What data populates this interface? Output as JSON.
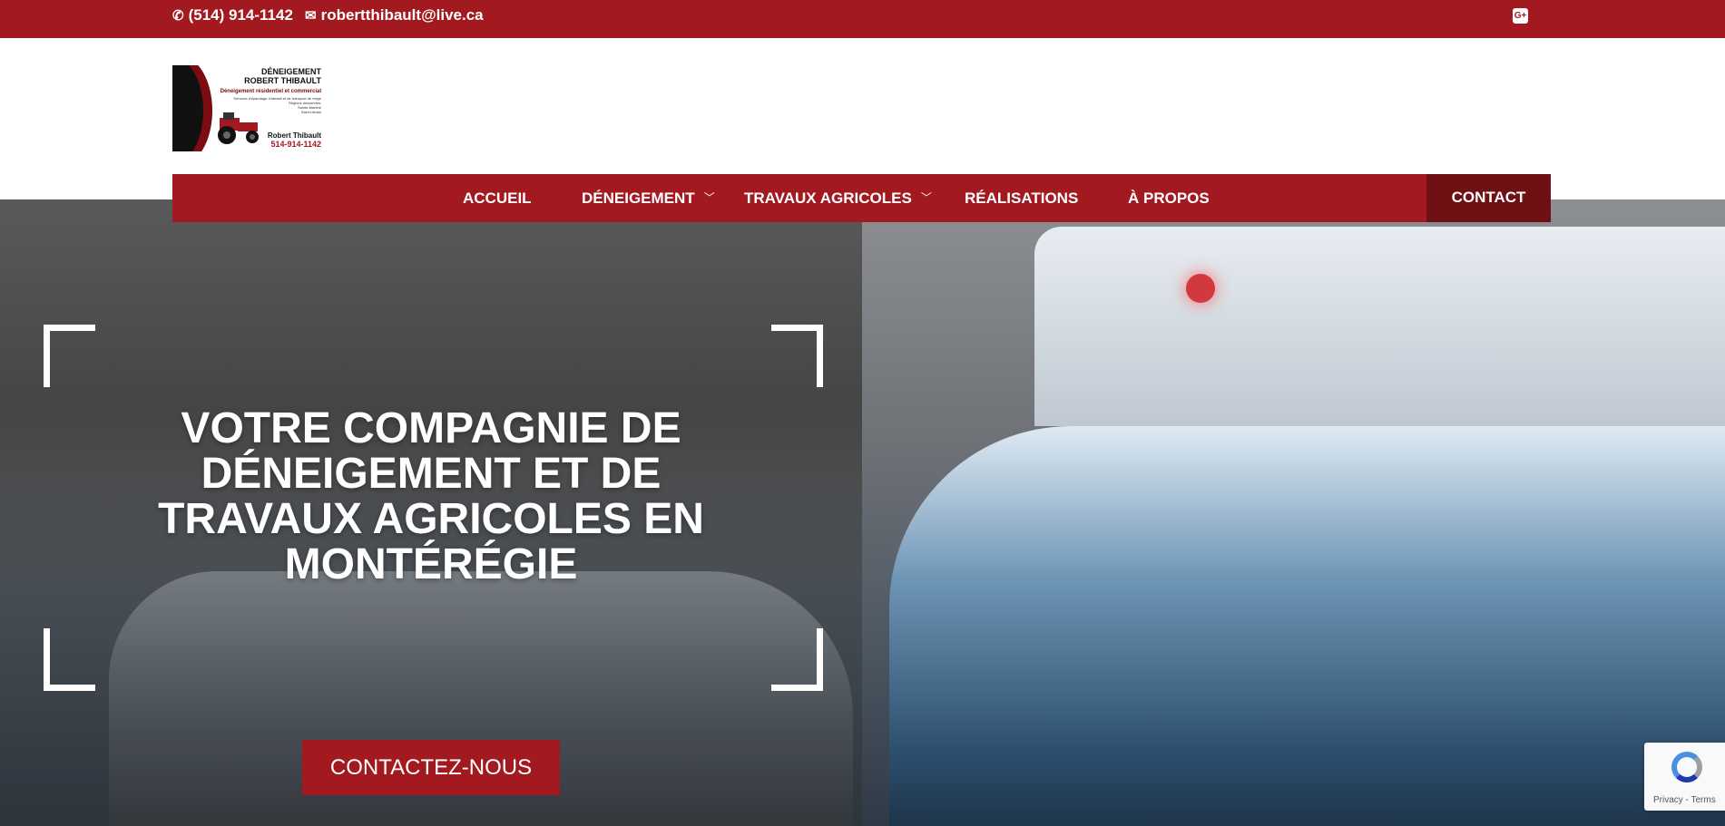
{
  "topbar": {
    "phone": "(514) 914-1142",
    "phone_icon": "phone-icon",
    "email": "robertthibault@live.ca",
    "email_icon": "envelope-icon",
    "social_icon": "google-icon",
    "social_label": "G+"
  },
  "logo": {
    "title_line1": "DÉNEIGEMENT",
    "title_line2": "ROBERT THIBAULT",
    "subtitle_line1": "Déneigement résidentiel et commercial",
    "subtitle_line2": "Services d'épandage d'abrasif et de transport de neige",
    "regions_label": "Régions desservies:",
    "region_1": "Sainte-Martine",
    "region_2": "Saint-Urbain",
    "owner": "Robert Thibault",
    "owner_phone": "514-914-1142"
  },
  "nav": {
    "items": [
      {
        "label": "ACCUEIL",
        "has_dropdown": false
      },
      {
        "label": "DÉNEIGEMENT",
        "has_dropdown": true
      },
      {
        "label": "TRAVAUX AGRICOLES",
        "has_dropdown": true
      },
      {
        "label": "RÉALISATIONS",
        "has_dropdown": false
      },
      {
        "label": "À PROPOS",
        "has_dropdown": false
      }
    ],
    "contact_label": "CONTACT",
    "caret_icon": "chevron-down-icon"
  },
  "hero": {
    "title": "VOTRE COMPAGNIE DE DÉNEIGEMENT ET DE TRAVAUX AGRICOLES EN MONTÉRÉGIE",
    "cta_label": "CONTACTEZ-NOUS"
  },
  "recaptcha": {
    "text": "Privacy - Terms"
  },
  "colors": {
    "brand_red": "#a31920",
    "contact_dark_red": "#6f1015",
    "white": "#ffffff"
  }
}
